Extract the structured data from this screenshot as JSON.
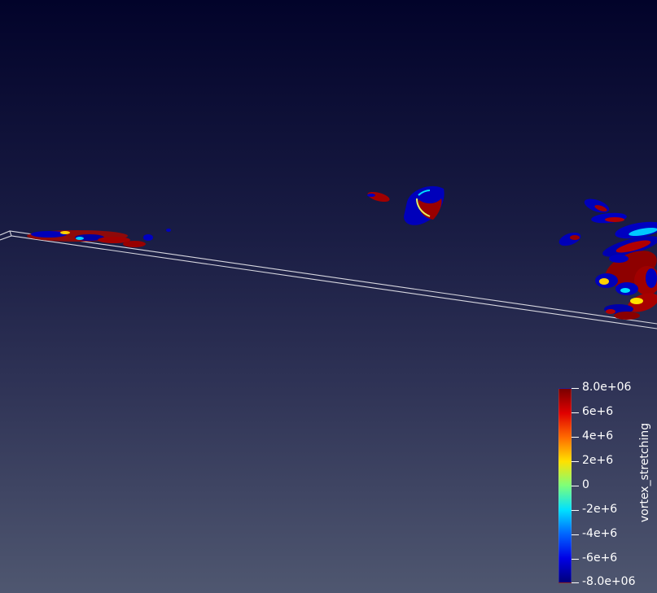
{
  "colorbar": {
    "title": "vortex_stretching",
    "tick_labels": [
      "8.0e+06",
      "6e+6",
      "4e+6",
      "2e+6",
      "0",
      "-2e+6",
      "-4e+6",
      "-6e+6",
      "-8.0e+06"
    ],
    "colors": [
      "#7a0000",
      "#e00000",
      "#ff6a00",
      "#ffe100",
      "#7dff7a",
      "#00e1ff",
      "#0065ff",
      "#0000e6",
      "#00007a"
    ]
  }
}
